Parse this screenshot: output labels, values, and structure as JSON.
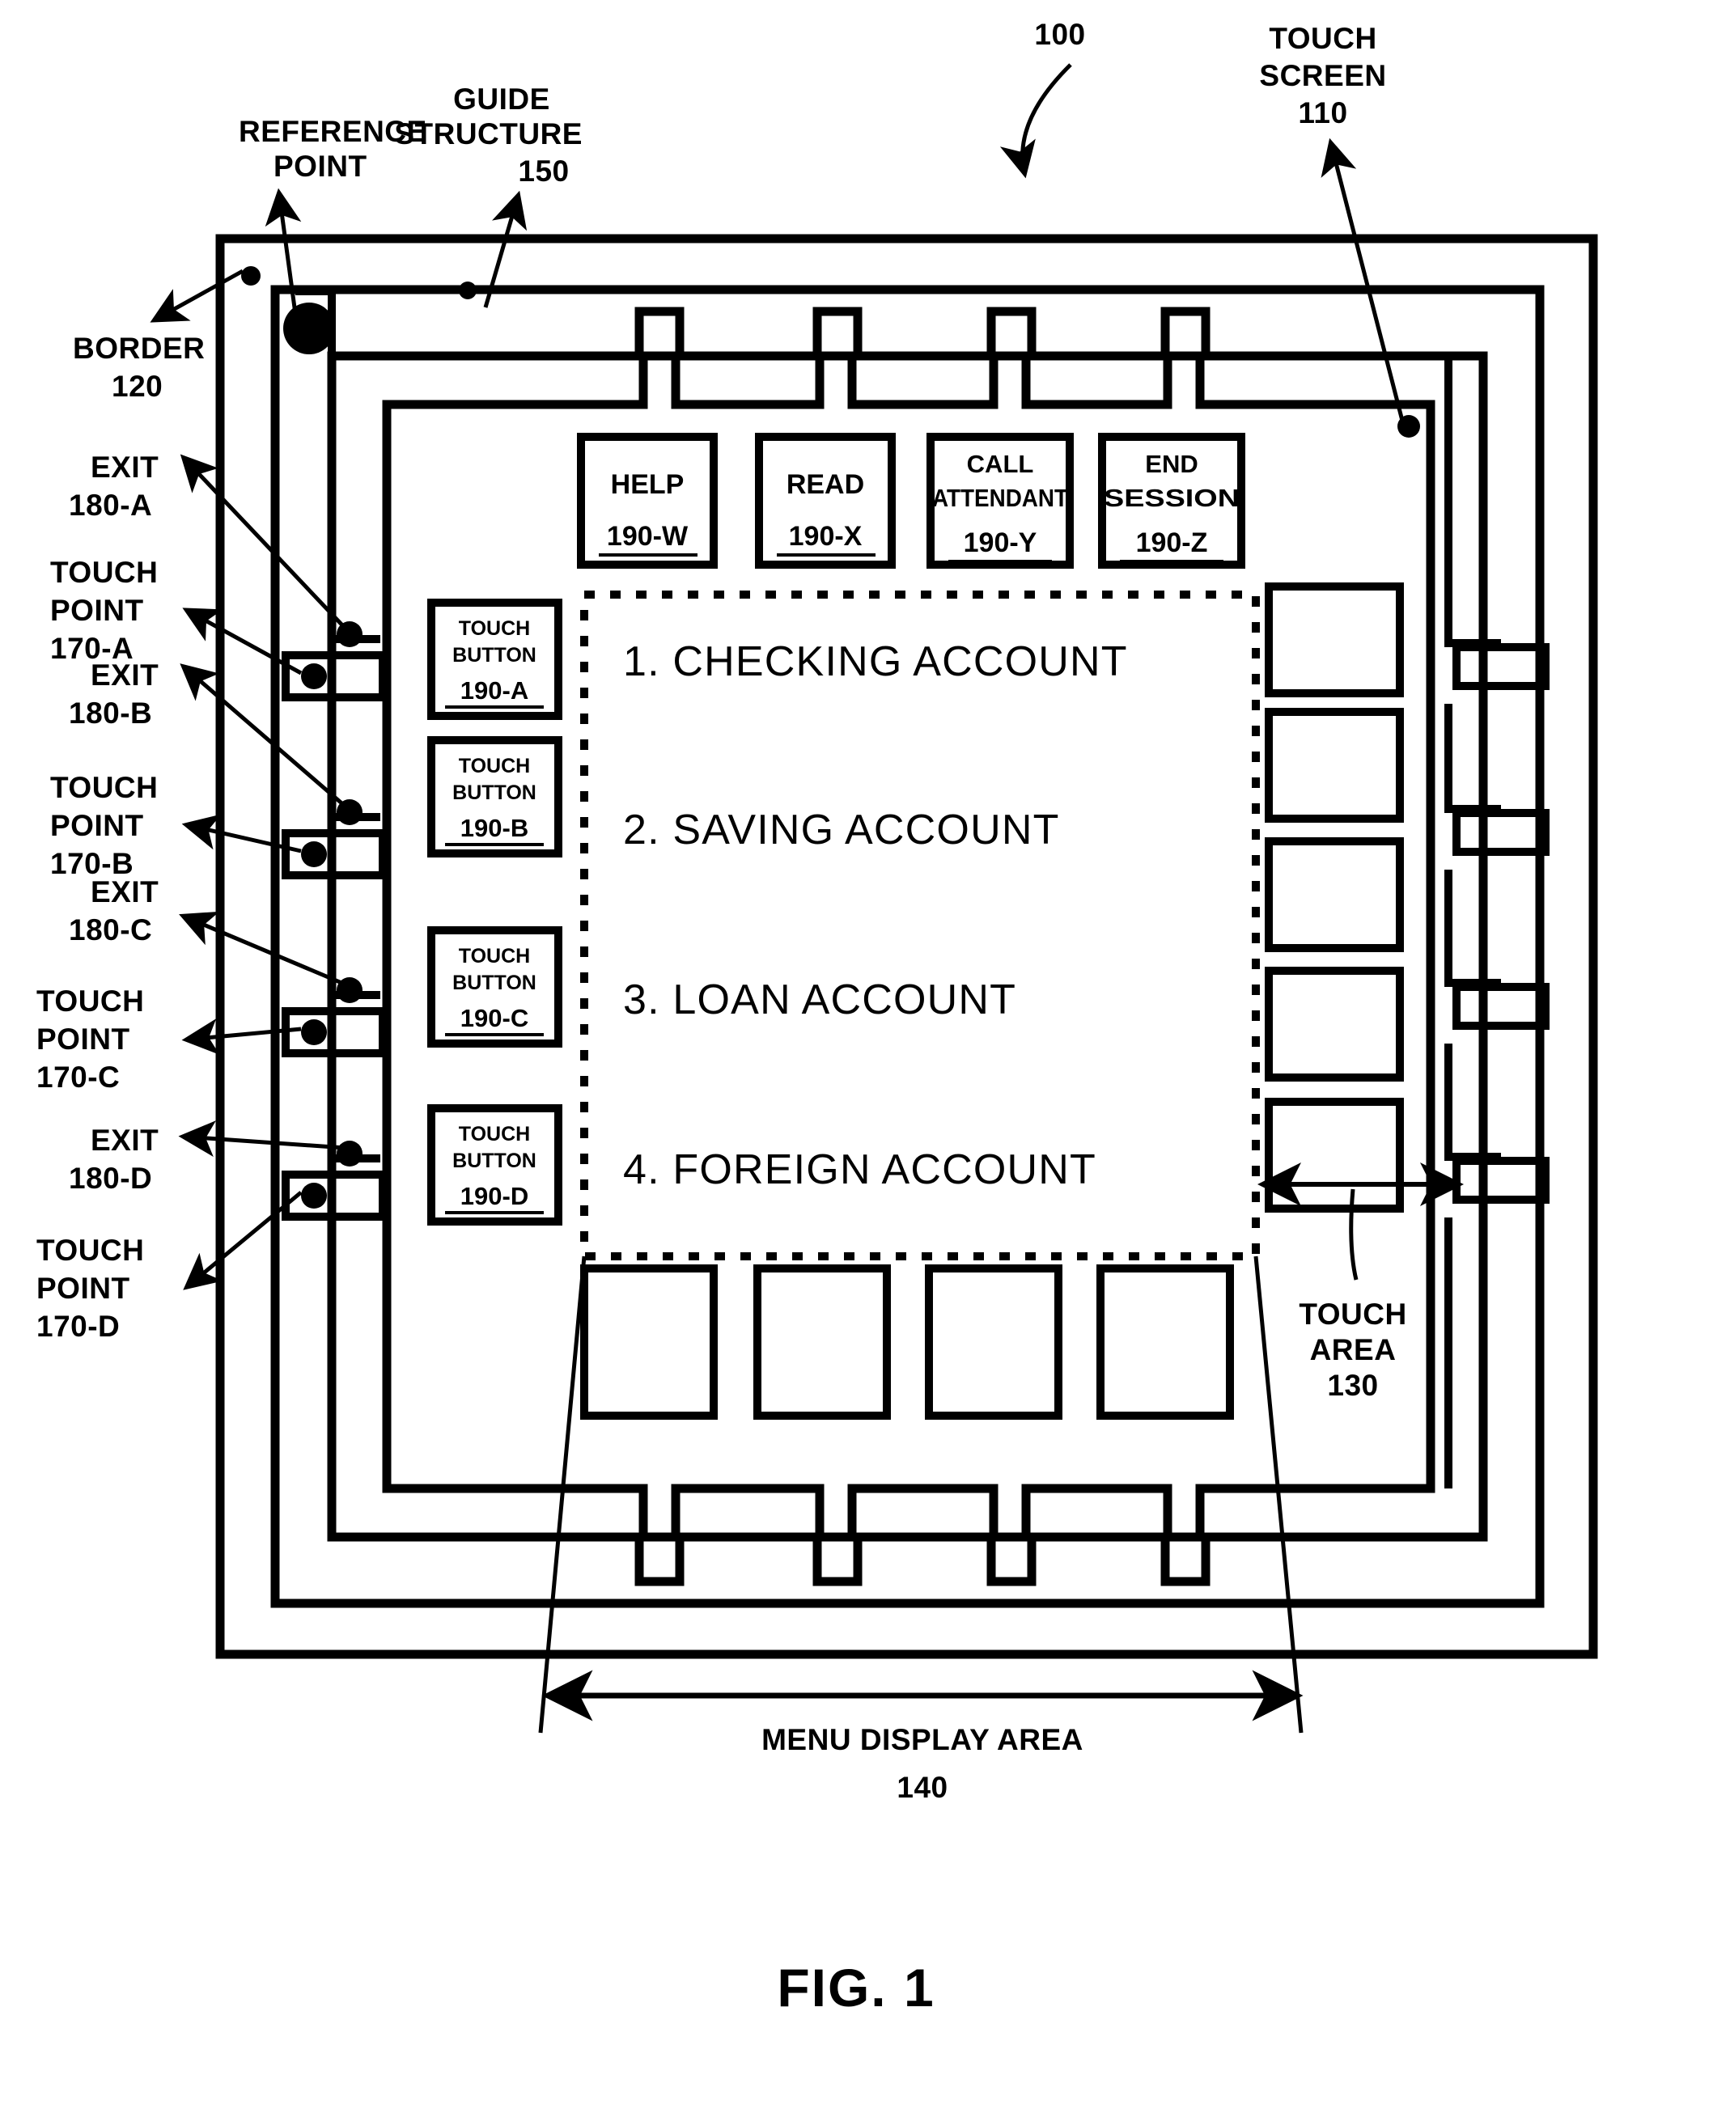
{
  "figure": {
    "caption": "FIG. 1",
    "device_ref": "100"
  },
  "callouts": {
    "reference_point": {
      "line1": "REFERENCE",
      "line2": "POINT"
    },
    "guide_structure": {
      "line1": "GUIDE",
      "line2": "STRUCTURE",
      "ref": "150"
    },
    "touch_screen": {
      "line1": "TOUCH",
      "line2": "SCREEN",
      "ref": "110"
    },
    "border": {
      "line1": "BORDER",
      "ref": "120"
    },
    "touch_area": {
      "line1": "TOUCH",
      "line2": "AREA",
      "ref": "130"
    },
    "menu_display_area": {
      "line1": "MENU DISPLAY AREA",
      "ref": "140"
    }
  },
  "exits": [
    {
      "label": "EXIT",
      "ref": "180-A"
    },
    {
      "label": "EXIT",
      "ref": "180-B"
    },
    {
      "label": "EXIT",
      "ref": "180-C"
    },
    {
      "label": "EXIT",
      "ref": "180-D"
    }
  ],
  "touch_points": [
    {
      "line1": "TOUCH",
      "line2": "POINT",
      "ref": "170-A"
    },
    {
      "line1": "TOUCH",
      "line2": "POINT",
      "ref": "170-B"
    },
    {
      "line1": "TOUCH",
      "line2": "POINT",
      "ref": "170-C"
    },
    {
      "line1": "TOUCH",
      "line2": "POINT",
      "ref": "170-D"
    }
  ],
  "top_buttons": [
    {
      "line1": "HELP",
      "line2": "",
      "ref": "190-W"
    },
    {
      "line1": "READ",
      "line2": "",
      "ref": "190-X"
    },
    {
      "line1": "CALL",
      "line2": "ATTENDANT",
      "ref": "190-Y"
    },
    {
      "line1": "END",
      "line2": "SESSION",
      "ref": "190-Z"
    }
  ],
  "touch_buttons": [
    {
      "line1": "TOUCH",
      "line2": "BUTTON",
      "ref": "190-A"
    },
    {
      "line1": "TOUCH",
      "line2": "BUTTON",
      "ref": "190-B"
    },
    {
      "line1": "TOUCH",
      "line2": "BUTTON",
      "ref": "190-C"
    },
    {
      "line1": "TOUCH",
      "line2": "BUTTON",
      "ref": "190-D"
    }
  ],
  "menu_items": [
    "1. CHECKING ACCOUNT",
    "2. SAVING ACCOUNT",
    "3. LOAN ACCOUNT",
    "4. FOREIGN ACCOUNT"
  ],
  "colors": {
    "ink": "#000000",
    "paper": "#ffffff"
  }
}
